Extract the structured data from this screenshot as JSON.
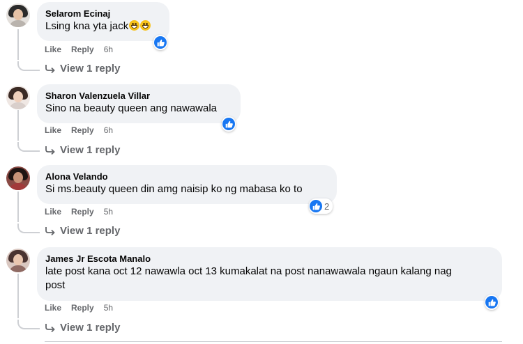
{
  "comments": [
    {
      "author": "Selarom Ecinaj",
      "text": "Lsing kna yta jack",
      "emojis": [
        "grinning-face-emoji",
        "grinning-face-emoji"
      ],
      "like": "Like",
      "reply": "Reply",
      "time": "6h",
      "reactions": {
        "icon": "like-icon",
        "count": ""
      },
      "view_replies": "View 1 reply"
    },
    {
      "author": "Sharon Valenzuela Villar",
      "text": "Sino na beauty queen ang nawawala",
      "like": "Like",
      "reply": "Reply",
      "time": "6h",
      "reactions": {
        "icon": "like-icon",
        "count": ""
      },
      "view_replies": "View 1 reply"
    },
    {
      "author": "Alona Velando",
      "text": "Si ms.beauty queen din amg naisip ko ng mabasa ko to",
      "like": "Like",
      "reply": "Reply",
      "time": "5h",
      "reactions": {
        "icon": "like-icon",
        "count": "2"
      },
      "view_replies": "View 1 reply"
    },
    {
      "author": "James Jr Escota Manalo",
      "text_line1": "late post kana oct 12 nawawla oct 13 kumakalat na post nanawawala ngaun kalang nag",
      "text_line2": "post",
      "like": "Like",
      "reply": "Reply",
      "time": "5h",
      "reactions": {
        "icon": "like-icon",
        "count": ""
      },
      "view_replies": "View 1 reply"
    }
  ],
  "colors": {
    "bubble": "#f0f2f5",
    "meta": "#65676b",
    "like_blue": "#1877f2",
    "thread_line": "#ced0d4"
  }
}
